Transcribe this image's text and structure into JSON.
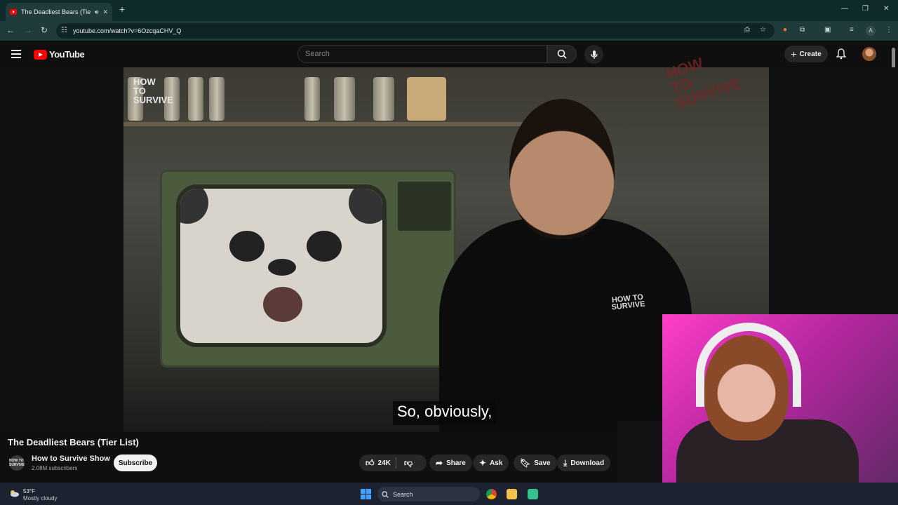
{
  "browser": {
    "tab_title": "The Deadliest Bears (Tier List)",
    "url": "youtube.com/watch?v=6OzcqaCHV_Q",
    "profile_initial": "A"
  },
  "youtube": {
    "logo_text": "YouTube",
    "search_placeholder": "Search",
    "create_label": "Create"
  },
  "video": {
    "overlay_brand": "HOW TO SURVIVE",
    "caption": "So, obviously,",
    "title": "The Deadliest Bears (Tier List)",
    "channel": {
      "name": "How to Survive Show",
      "subscribers": "2.08M subscribers",
      "avatar_text": "HOW TO SURVIVE"
    },
    "actions": {
      "subscribe": "Subscribe",
      "likes": "24K",
      "share": "Share",
      "ask": "Ask",
      "save": "Save",
      "download": "Download"
    }
  },
  "taskbar": {
    "temperature": "53°F",
    "weather": "Mostly cloudy",
    "search_label": "Search"
  },
  "colors": {
    "youtube_red": "#ff0000",
    "browser_frame": "#1f3b3b",
    "webcam_pink": "#ff3ec9"
  }
}
